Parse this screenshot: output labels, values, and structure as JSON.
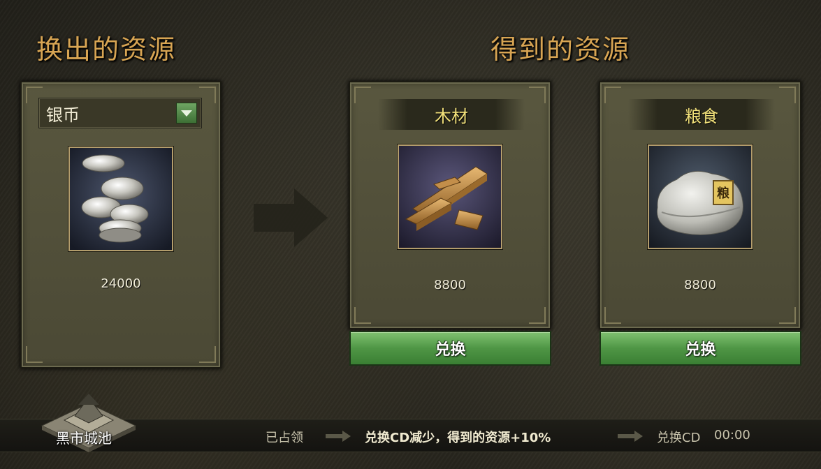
{
  "titles": {
    "left": "换出的资源",
    "right": "得到的资源"
  },
  "source": {
    "selected": "银币",
    "amount": "24000",
    "icon": "silver-coins-icon"
  },
  "targets": [
    {
      "name": "木材",
      "amount": "8800",
      "button": "兑换",
      "icon": "wood-planks-icon"
    },
    {
      "name": "粮食",
      "amount": "8800",
      "button": "兑换",
      "icon": "grain-sack-icon",
      "sack_label": "粮"
    }
  ],
  "bottom": {
    "city_label": "黑市城池",
    "status": "已占领",
    "bonus": "兑换CD减少，得到的资源+10%",
    "cd_label": "兑换CD",
    "cd_time": "00:00"
  },
  "colors": {
    "title_gold": "#d8a553",
    "resource_name_yellow": "#f2e17a",
    "button_green": "#4f9645",
    "bonus_text": "#f0ead0"
  }
}
